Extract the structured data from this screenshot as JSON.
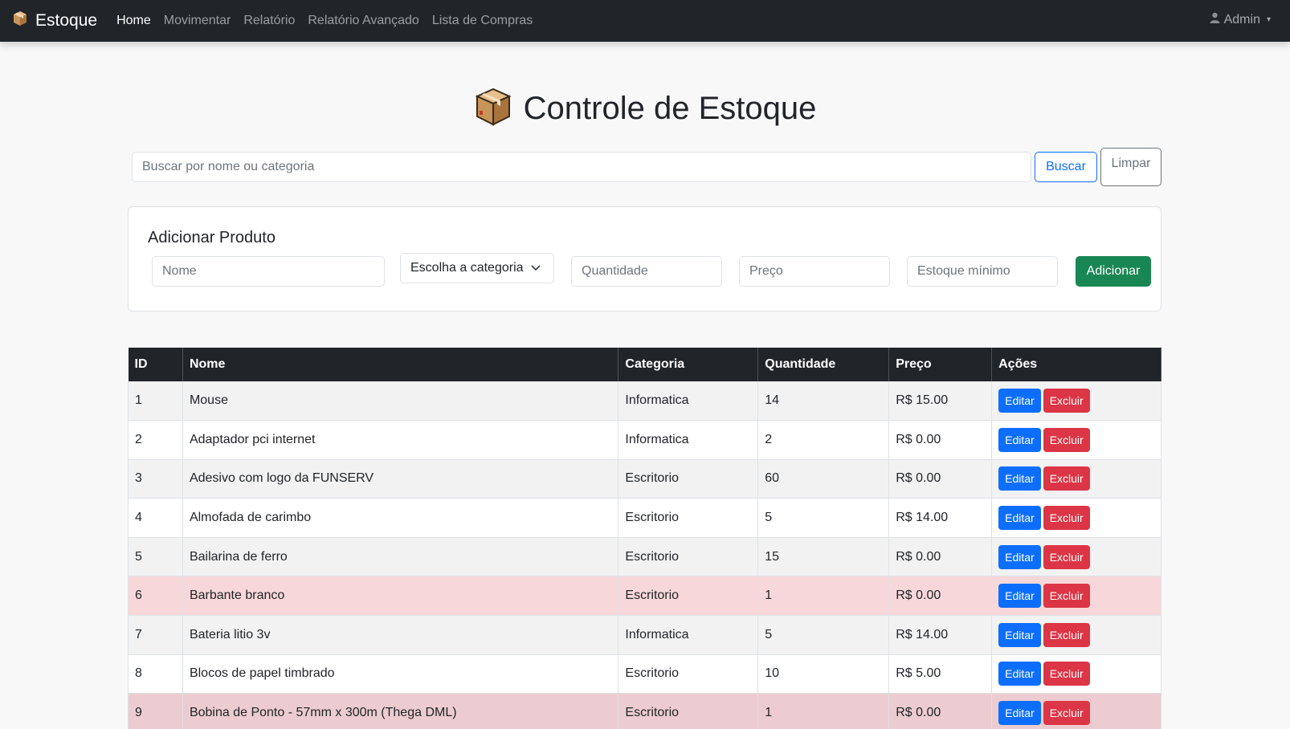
{
  "navbar": {
    "brand": "Estoque",
    "links": [
      {
        "label": "Home",
        "active": true
      },
      {
        "label": "Movimentar",
        "active": false
      },
      {
        "label": "Relatório",
        "active": false
      },
      {
        "label": "Relatório Avançado",
        "active": false
      },
      {
        "label": "Lista de Compras",
        "active": false
      }
    ],
    "user": "Admin"
  },
  "page_title": "Controle de Estoque",
  "search": {
    "placeholder": "Buscar por nome ou categoria",
    "value": "",
    "search_label": "Buscar",
    "clear_label": "Limpar"
  },
  "add_form": {
    "title": "Adicionar Produto",
    "name_placeholder": "Nome",
    "category_selected": "Escolha a categoria",
    "quantity_placeholder": "Quantidade",
    "price_placeholder": "Preço",
    "min_stock_placeholder": "Estoque mínimo",
    "submit_label": "Adicionar"
  },
  "table": {
    "headers": [
      "ID",
      "Nome",
      "Categoria",
      "Quantidade",
      "Preço",
      "Ações"
    ],
    "edit_label": "Editar",
    "delete_label": "Excluir",
    "rows": [
      {
        "id": "1",
        "name": "Mouse",
        "category": "Informatica",
        "quantity": "14",
        "price": "R$ 15.00",
        "low_stock": false
      },
      {
        "id": "2",
        "name": "Adaptador pci internet",
        "category": "Informatica",
        "quantity": "2",
        "price": "R$ 0.00",
        "low_stock": false
      },
      {
        "id": "3",
        "name": "Adesivo com logo da FUNSERV",
        "category": "Escritorio",
        "quantity": "60",
        "price": "R$ 0.00",
        "low_stock": false
      },
      {
        "id": "4",
        "name": "Almofada de carimbo",
        "category": "Escritorio",
        "quantity": "5",
        "price": "R$ 14.00",
        "low_stock": false
      },
      {
        "id": "5",
        "name": "Bailarina de ferro",
        "category": "Escritorio",
        "quantity": "15",
        "price": "R$ 0.00",
        "low_stock": false
      },
      {
        "id": "6",
        "name": "Barbante branco",
        "category": "Escritorio",
        "quantity": "1",
        "price": "R$ 0.00",
        "low_stock": true
      },
      {
        "id": "7",
        "name": "Bateria litio 3v",
        "category": "Informatica",
        "quantity": "5",
        "price": "R$ 14.00",
        "low_stock": false
      },
      {
        "id": "8",
        "name": "Blocos de papel timbrado",
        "category": "Escritorio",
        "quantity": "10",
        "price": "R$ 5.00",
        "low_stock": false
      },
      {
        "id": "9",
        "name": "Bobina de Ponto - 57mm x 300m (Thega DML)",
        "category": "Escritorio",
        "quantity": "1",
        "price": "R$ 0.00",
        "low_stock": true
      }
    ]
  },
  "colors": {
    "navbar": "#212529",
    "primary": "#0d6efd",
    "success": "#198754",
    "danger": "#dc3545",
    "low_stock_row": "#f8d7da"
  },
  "icons": {
    "brand": "package-box-icon",
    "title": "package-box-icon",
    "user": "user-icon",
    "caret": "caret-down-icon",
    "select": "chevron-down-icon"
  }
}
